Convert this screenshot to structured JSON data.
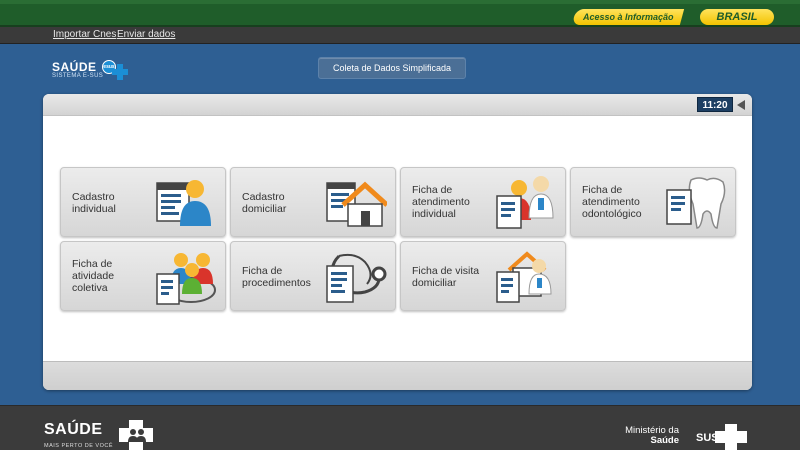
{
  "gov_bar": {
    "acesso_label": "Acesso à Informação",
    "brasil_label": "BRASIL"
  },
  "nav": {
    "import_label": "Importar Cnes",
    "send_label": "Enviar dados"
  },
  "logo": {
    "title": "SAÚDE",
    "subtitle": "SISTEMA E-SUS",
    "badge": "esus"
  },
  "header": {
    "title": "Coleta de Dados Simplificada"
  },
  "clock": "11:20",
  "tiles": [
    {
      "label": "Cadastro individual",
      "icon": "person-card-icon"
    },
    {
      "label": "Cadastro domiciliar",
      "icon": "house-icon"
    },
    {
      "label": "Ficha de atendimento individual",
      "icon": "doctor-patient-icon"
    },
    {
      "label": "Ficha de atendimento odontológico",
      "icon": "tooth-icon"
    },
    {
      "label": "Ficha de atividade coletiva",
      "icon": "group-icon"
    },
    {
      "label": "Ficha de procedimentos",
      "icon": "stethoscope-icon"
    },
    {
      "label": "Ficha de visita domiciliar",
      "icon": "home-visit-icon"
    }
  ],
  "footer": {
    "logo": "SAÚDE",
    "tagline": "MAIS PERTO DE VOCÊ",
    "ministerio_line1": "Ministério da",
    "ministerio_line2": "Saúde",
    "sus": "SUS"
  },
  "colors": {
    "background": "#2e5f93",
    "gov_green": "#1f5d2a",
    "yellow": "#f3c200",
    "clock_bg": "#1d3f63"
  }
}
